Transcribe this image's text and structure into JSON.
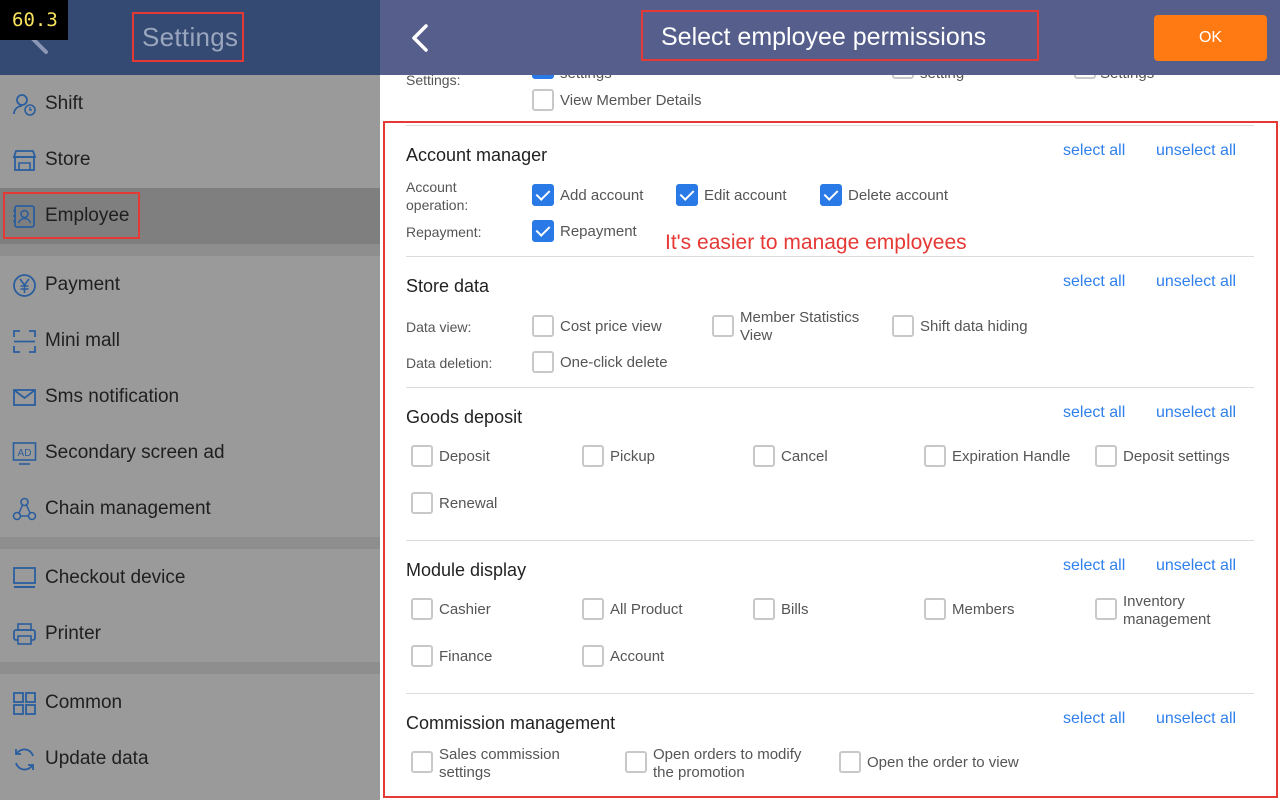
{
  "fps_overlay": "60.3",
  "sidebar": {
    "title": "Settings",
    "items": [
      {
        "label": "Shift",
        "icon": "user-clock-icon"
      },
      {
        "label": "Store",
        "icon": "store-icon"
      },
      {
        "label": "Employee",
        "icon": "employee-badge-icon",
        "active": true
      },
      {
        "label": "Payment",
        "icon": "yen-circle-icon"
      },
      {
        "label": "Mini mall",
        "icon": "mini-mall-icon"
      },
      {
        "label": "Sms notification",
        "icon": "envelope-icon"
      },
      {
        "label": "Secondary screen ad",
        "icon": "ad-icon"
      },
      {
        "label": "Chain management",
        "icon": "chain-nodes-icon"
      },
      {
        "label": "Checkout device",
        "icon": "monitor-icon"
      },
      {
        "label": "Printer",
        "icon": "printer-icon"
      },
      {
        "label": "Common",
        "icon": "grid-icon"
      },
      {
        "label": "Update data",
        "icon": "refresh-icon"
      }
    ]
  },
  "header": {
    "title": "Select employee permissions",
    "ok_label": "OK"
  },
  "top_partial": {
    "label": "Settings:",
    "partial_texts": [
      "settings",
      "setting",
      "Settings"
    ],
    "view_member_details": "View Member Details"
  },
  "select_all_label": "select all",
  "unselect_all_label": "unselect all",
  "annotation_text": "It's easier to manage employees",
  "sections": {
    "account_manager": {
      "title": "Account manager",
      "row1_label": "Account operation:",
      "row2_label": "Repayment:",
      "add_account": "Add account",
      "edit_account": "Edit account",
      "delete_account": "Delete account",
      "repayment": "Repayment"
    },
    "store_data": {
      "title": "Store data",
      "row1_label": "Data view:",
      "row2_label": "Data deletion:",
      "cost_price_view": "Cost price view",
      "member_statistics_view": "Member Statistics View",
      "shift_data_hiding": "Shift data hiding",
      "one_click_delete": "One-click delete"
    },
    "goods_deposit": {
      "title": "Goods deposit",
      "deposit": "Deposit",
      "pickup": "Pickup",
      "cancel": "Cancel",
      "expiration_handle": "Expiration Handle",
      "deposit_settings": "Deposit settings",
      "renewal": "Renewal"
    },
    "module_display": {
      "title": "Module display",
      "cashier": "Cashier",
      "all_product": "All Product",
      "bills": "Bills",
      "members": "Members",
      "inventory_management": "Inventory management",
      "finance": "Finance",
      "account": "Account"
    },
    "commission_management": {
      "title": "Commission management",
      "sales_commission_settings": "Sales commission settings",
      "open_orders_modify": "Open orders to modify the promotion",
      "open_order_view": "Open the order to view"
    }
  },
  "colors": {
    "sidebar_header": "#344a73",
    "panel_header": "#565f8c",
    "ok_button": "#ff7a12",
    "link": "#2f80ed",
    "checkbox_checked": "#2979e6",
    "annotation": "#e53935"
  }
}
